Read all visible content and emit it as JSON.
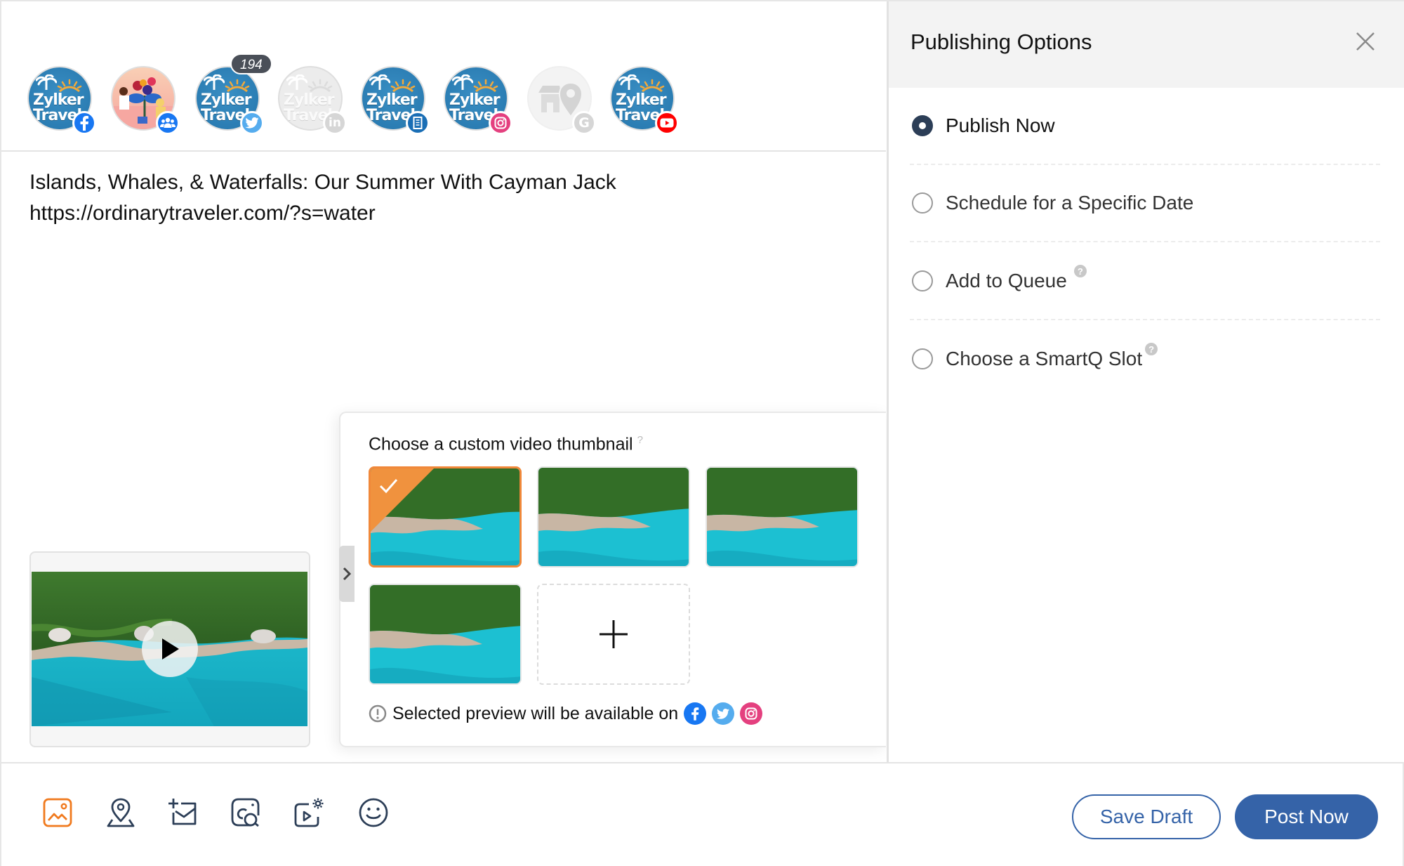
{
  "accounts": [
    {
      "name": "Zylker Travel",
      "network": "facebook",
      "avatar": "zylker-logo",
      "enabled": true
    },
    {
      "name": "Group",
      "network": "facebook-group",
      "avatar": "group-illustration",
      "enabled": true
    },
    {
      "name": "Zylker Travel",
      "network": "twitter",
      "avatar": "zylker-logo",
      "enabled": true,
      "count": "194"
    },
    {
      "name": "Zylker Travel",
      "network": "linkedin",
      "avatar": "zylker-logo",
      "enabled": false
    },
    {
      "name": "Zylker Travel",
      "network": "linkedin-page",
      "avatar": "zylker-logo",
      "enabled": true
    },
    {
      "name": "Zylker Travel",
      "network": "instagram",
      "avatar": "zylker-logo",
      "enabled": true
    },
    {
      "name": "Google My Business",
      "network": "google",
      "avatar": "store-location",
      "enabled": false
    },
    {
      "name": "Zylker Travel",
      "network": "youtube",
      "avatar": "zylker-logo",
      "enabled": true
    }
  ],
  "brand_line1": "Zylker",
  "brand_line2": "Travel",
  "post": {
    "title": "Islands, Whales, & Waterfalls: Our Summer With Cayman Jack",
    "url": "https://ordinarytraveler.com/?s=water"
  },
  "thumbnail_picker": {
    "title": "Choose a custom video thumbnail",
    "help": "?",
    "selected_index": 0,
    "thumbnails": [
      "frame-1",
      "frame-2",
      "frame-3",
      "frame-4"
    ],
    "note": "Selected preview will be available on",
    "note_networks": [
      "facebook",
      "twitter",
      "instagram"
    ]
  },
  "toolbar": {
    "tools": [
      "image",
      "location",
      "add-message",
      "media-library",
      "video-settings",
      "emoji"
    ],
    "save_draft_label": "Save Draft",
    "post_now_label": "Post Now"
  },
  "publishing": {
    "title": "Publishing Options",
    "options": [
      {
        "label": "Publish Now",
        "selected": true,
        "help": false
      },
      {
        "label": "Schedule for a Specific Date",
        "selected": false,
        "help": false
      },
      {
        "label": "Add to Queue",
        "selected": false,
        "help": true
      },
      {
        "label": "Choose a SmartQ Slot",
        "selected": false,
        "help": true
      }
    ],
    "help_glyph": "?"
  },
  "colors": {
    "accent_blue": "#3563a8",
    "selected_orange": "#f0883a",
    "radio_selected": "#2c3e57",
    "facebook": "#1877f2",
    "twitter": "#55acee",
    "instagram": "#e4407f",
    "youtube": "#ff0000",
    "linkedin_page": "#1a6eb5"
  }
}
